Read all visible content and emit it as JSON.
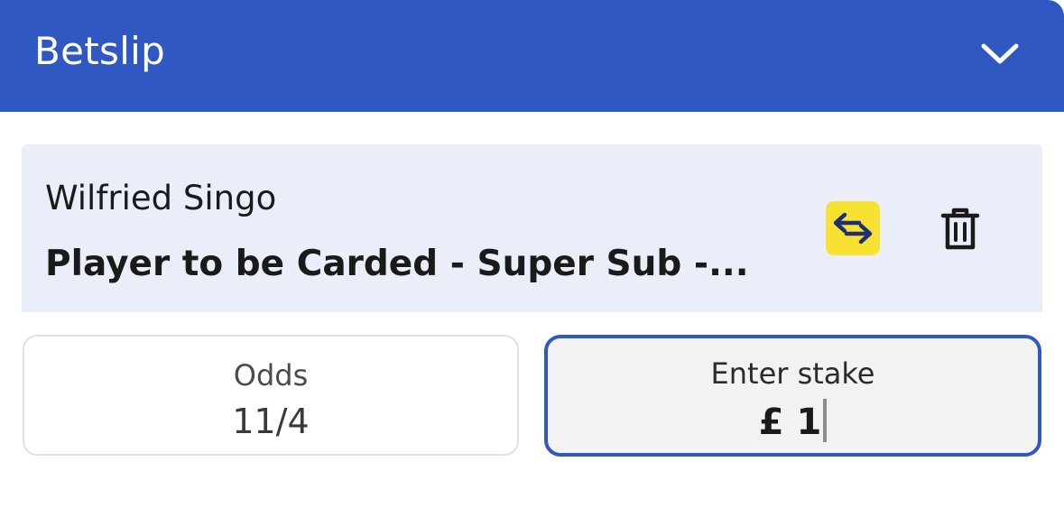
{
  "header": {
    "title": "Betslip",
    "collapse_icon": "chevron-down-icon",
    "background_color": "#3058c2"
  },
  "selection": {
    "player_name": "Wilfried Singo",
    "market": "Player to be Carded - Super Sub -...",
    "swap_icon": "swap-arrows-icon",
    "swap_color": "#f7e234",
    "delete_icon": "trash-icon"
  },
  "odds": {
    "label": "Odds",
    "value": "11/4"
  },
  "stake": {
    "label": "Enter stake",
    "currency": "£",
    "value": "1",
    "border_color": "#3058c2"
  }
}
